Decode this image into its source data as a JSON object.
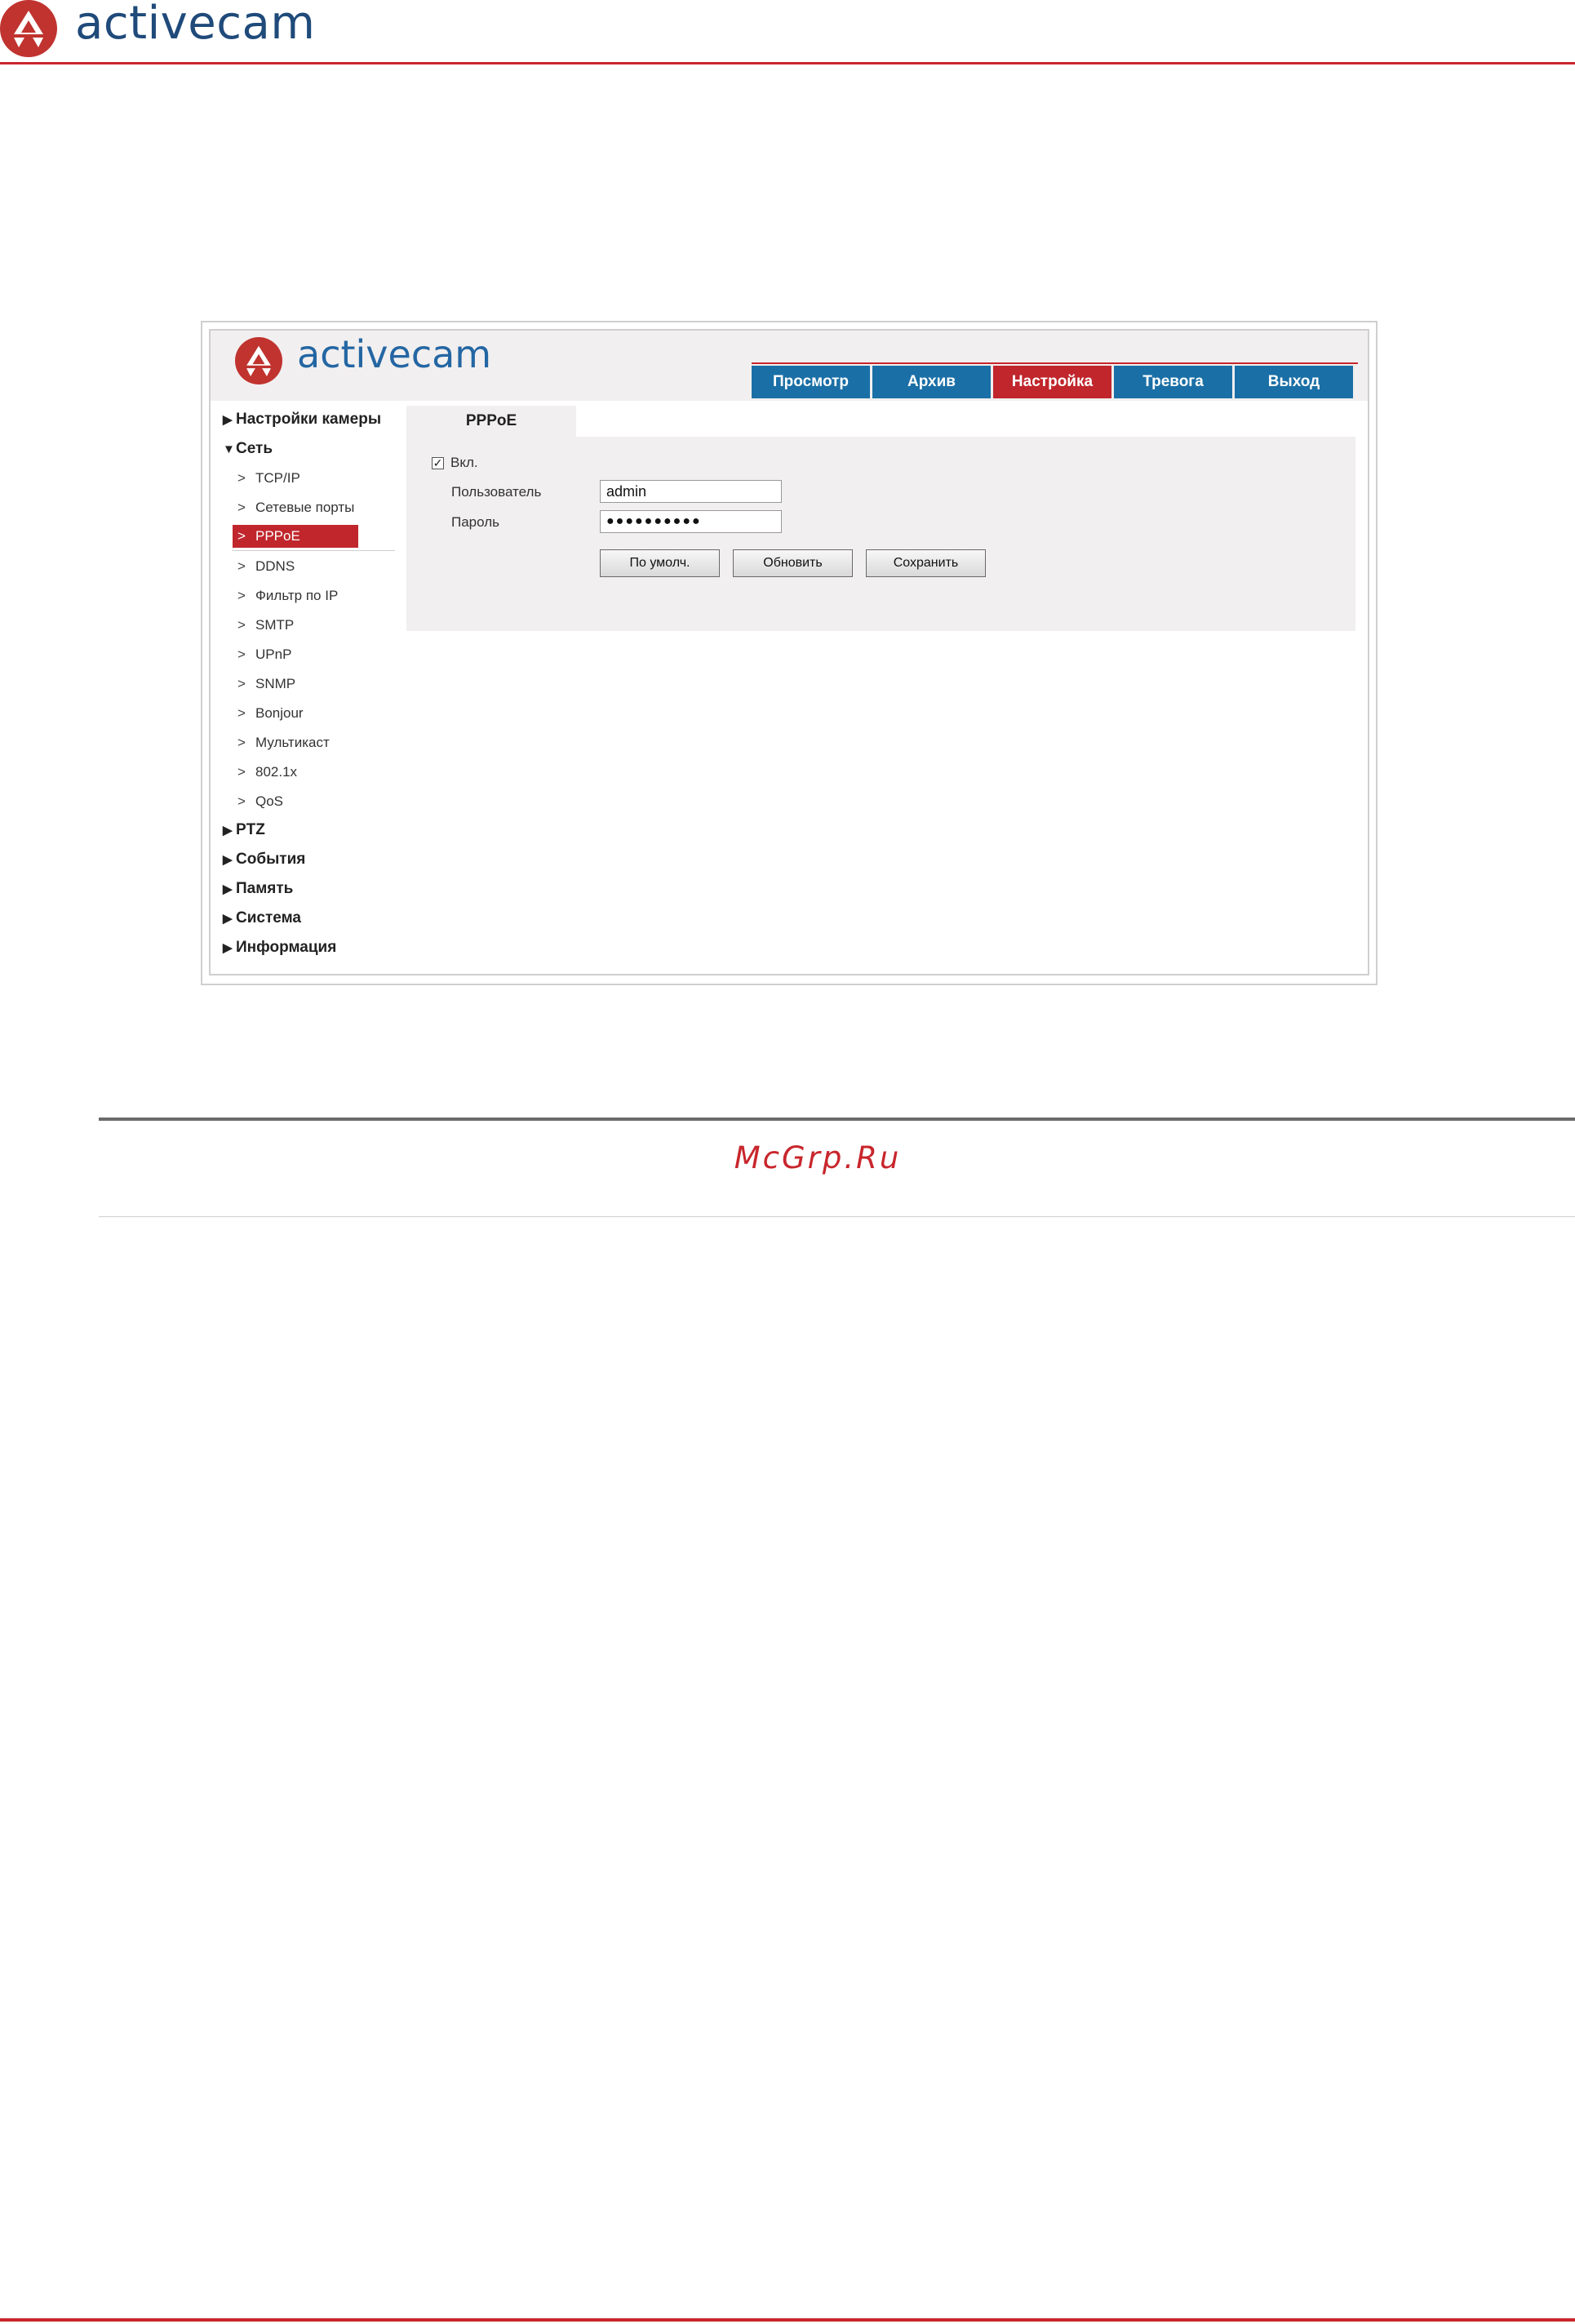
{
  "page": {
    "logo_text": "activecam",
    "watermark": "McGrp.Ru"
  },
  "app": {
    "logo_text": "activecam",
    "tabs": [
      {
        "label": "Просмотр",
        "active": false
      },
      {
        "label": "Архив",
        "active": false
      },
      {
        "label": "Настройка",
        "active": true
      },
      {
        "label": "Тревога",
        "active": false
      },
      {
        "label": "Выход",
        "active": false
      }
    ],
    "sidebar": {
      "camera_settings": "Настройки камеры",
      "network": "Сеть",
      "network_items": [
        {
          "label": "TCP/IP"
        },
        {
          "label": "Сетевые порты"
        },
        {
          "label": "PPPoE",
          "active": true
        },
        {
          "label": "DDNS"
        },
        {
          "label": "Фильтр по IP"
        },
        {
          "label": "SMTP"
        },
        {
          "label": "UPnP"
        },
        {
          "label": "SNMP"
        },
        {
          "label": "Bonjour"
        },
        {
          "label": "Мультикаст"
        },
        {
          "label": "802.1x"
        },
        {
          "label": "QoS"
        }
      ],
      "ptz": "PTZ",
      "events": "События",
      "storage": "Память",
      "system": "Система",
      "info": "Информация"
    },
    "content": {
      "tab_label": "PPPoE",
      "enable_label": "Вкл.",
      "enable_checked": true,
      "user_label": "Пользователь",
      "user_value": "admin",
      "password_label": "Пароль",
      "password_value": "●●●●●●●●●●",
      "buttons": {
        "default": "По умолч.",
        "refresh": "Обновить",
        "save": "Сохранить"
      }
    }
  },
  "colors": {
    "brand_red": "#c8262c",
    "tab_blue": "#1a6fa6",
    "logo_blue": "#2466a3",
    "page_logo_navy": "#1f4a7a"
  }
}
